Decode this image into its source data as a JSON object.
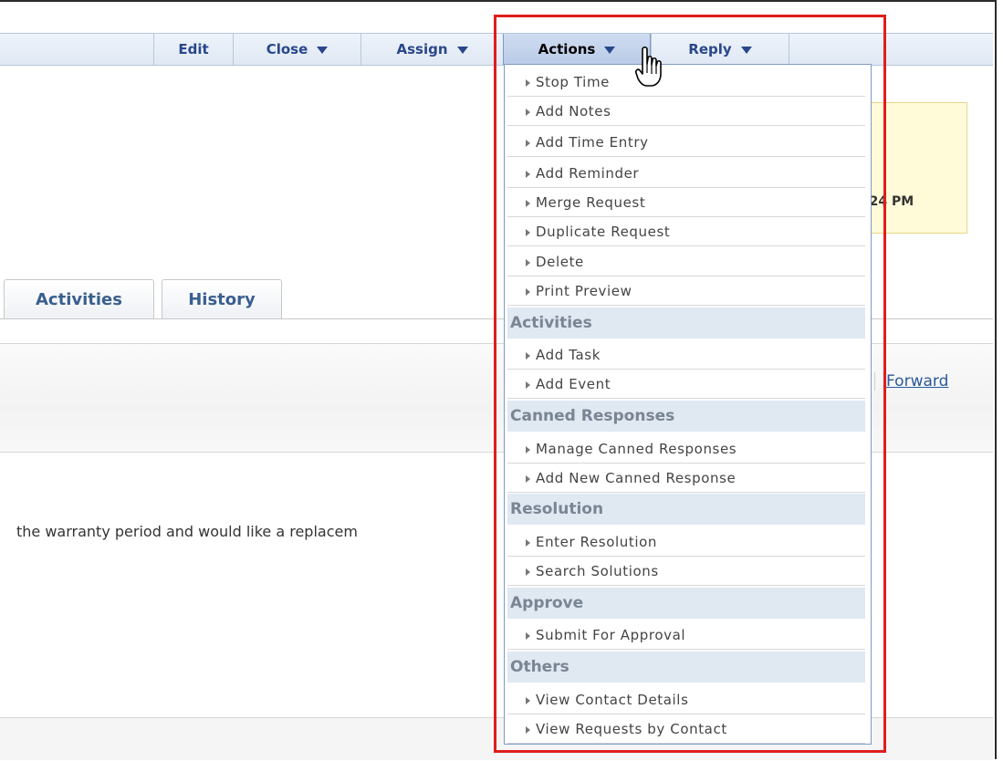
{
  "toolbar": {
    "edit": "Edit",
    "close": "Close",
    "assign": "Assign",
    "actions": "Actions",
    "reply": "Reply"
  },
  "info": {
    "time_fragment": ":24 PM"
  },
  "tabs": {
    "activities": "Activities",
    "history": "History"
  },
  "links": {
    "forward": "Forward"
  },
  "content": {
    "description": "the warranty period and would like a replacem"
  },
  "menu": {
    "items_main": [
      "Stop Time",
      "Add Notes",
      "Add Time Entry",
      "Add Reminder",
      "Merge Request",
      "Duplicate Request",
      "Delete",
      "Print Preview"
    ],
    "activities_header": "Activities",
    "activities_items": [
      "Add Task",
      "Add Event"
    ],
    "canned_header": "Canned Responses",
    "canned_items": [
      "Manage Canned Responses",
      "Add New Canned Response"
    ],
    "resolution_header": "Resolution",
    "resolution_items": [
      "Enter Resolution",
      "Search Solutions"
    ],
    "approve_header": "Approve",
    "approve_items": [
      "Submit For Approval"
    ],
    "others_header": "Others",
    "others_items": [
      "View Contact Details",
      "View Requests by Contact"
    ]
  },
  "colors": {
    "highlight": "#e01d1d",
    "link": "#2a5b9a",
    "header_text": "#29478a"
  }
}
